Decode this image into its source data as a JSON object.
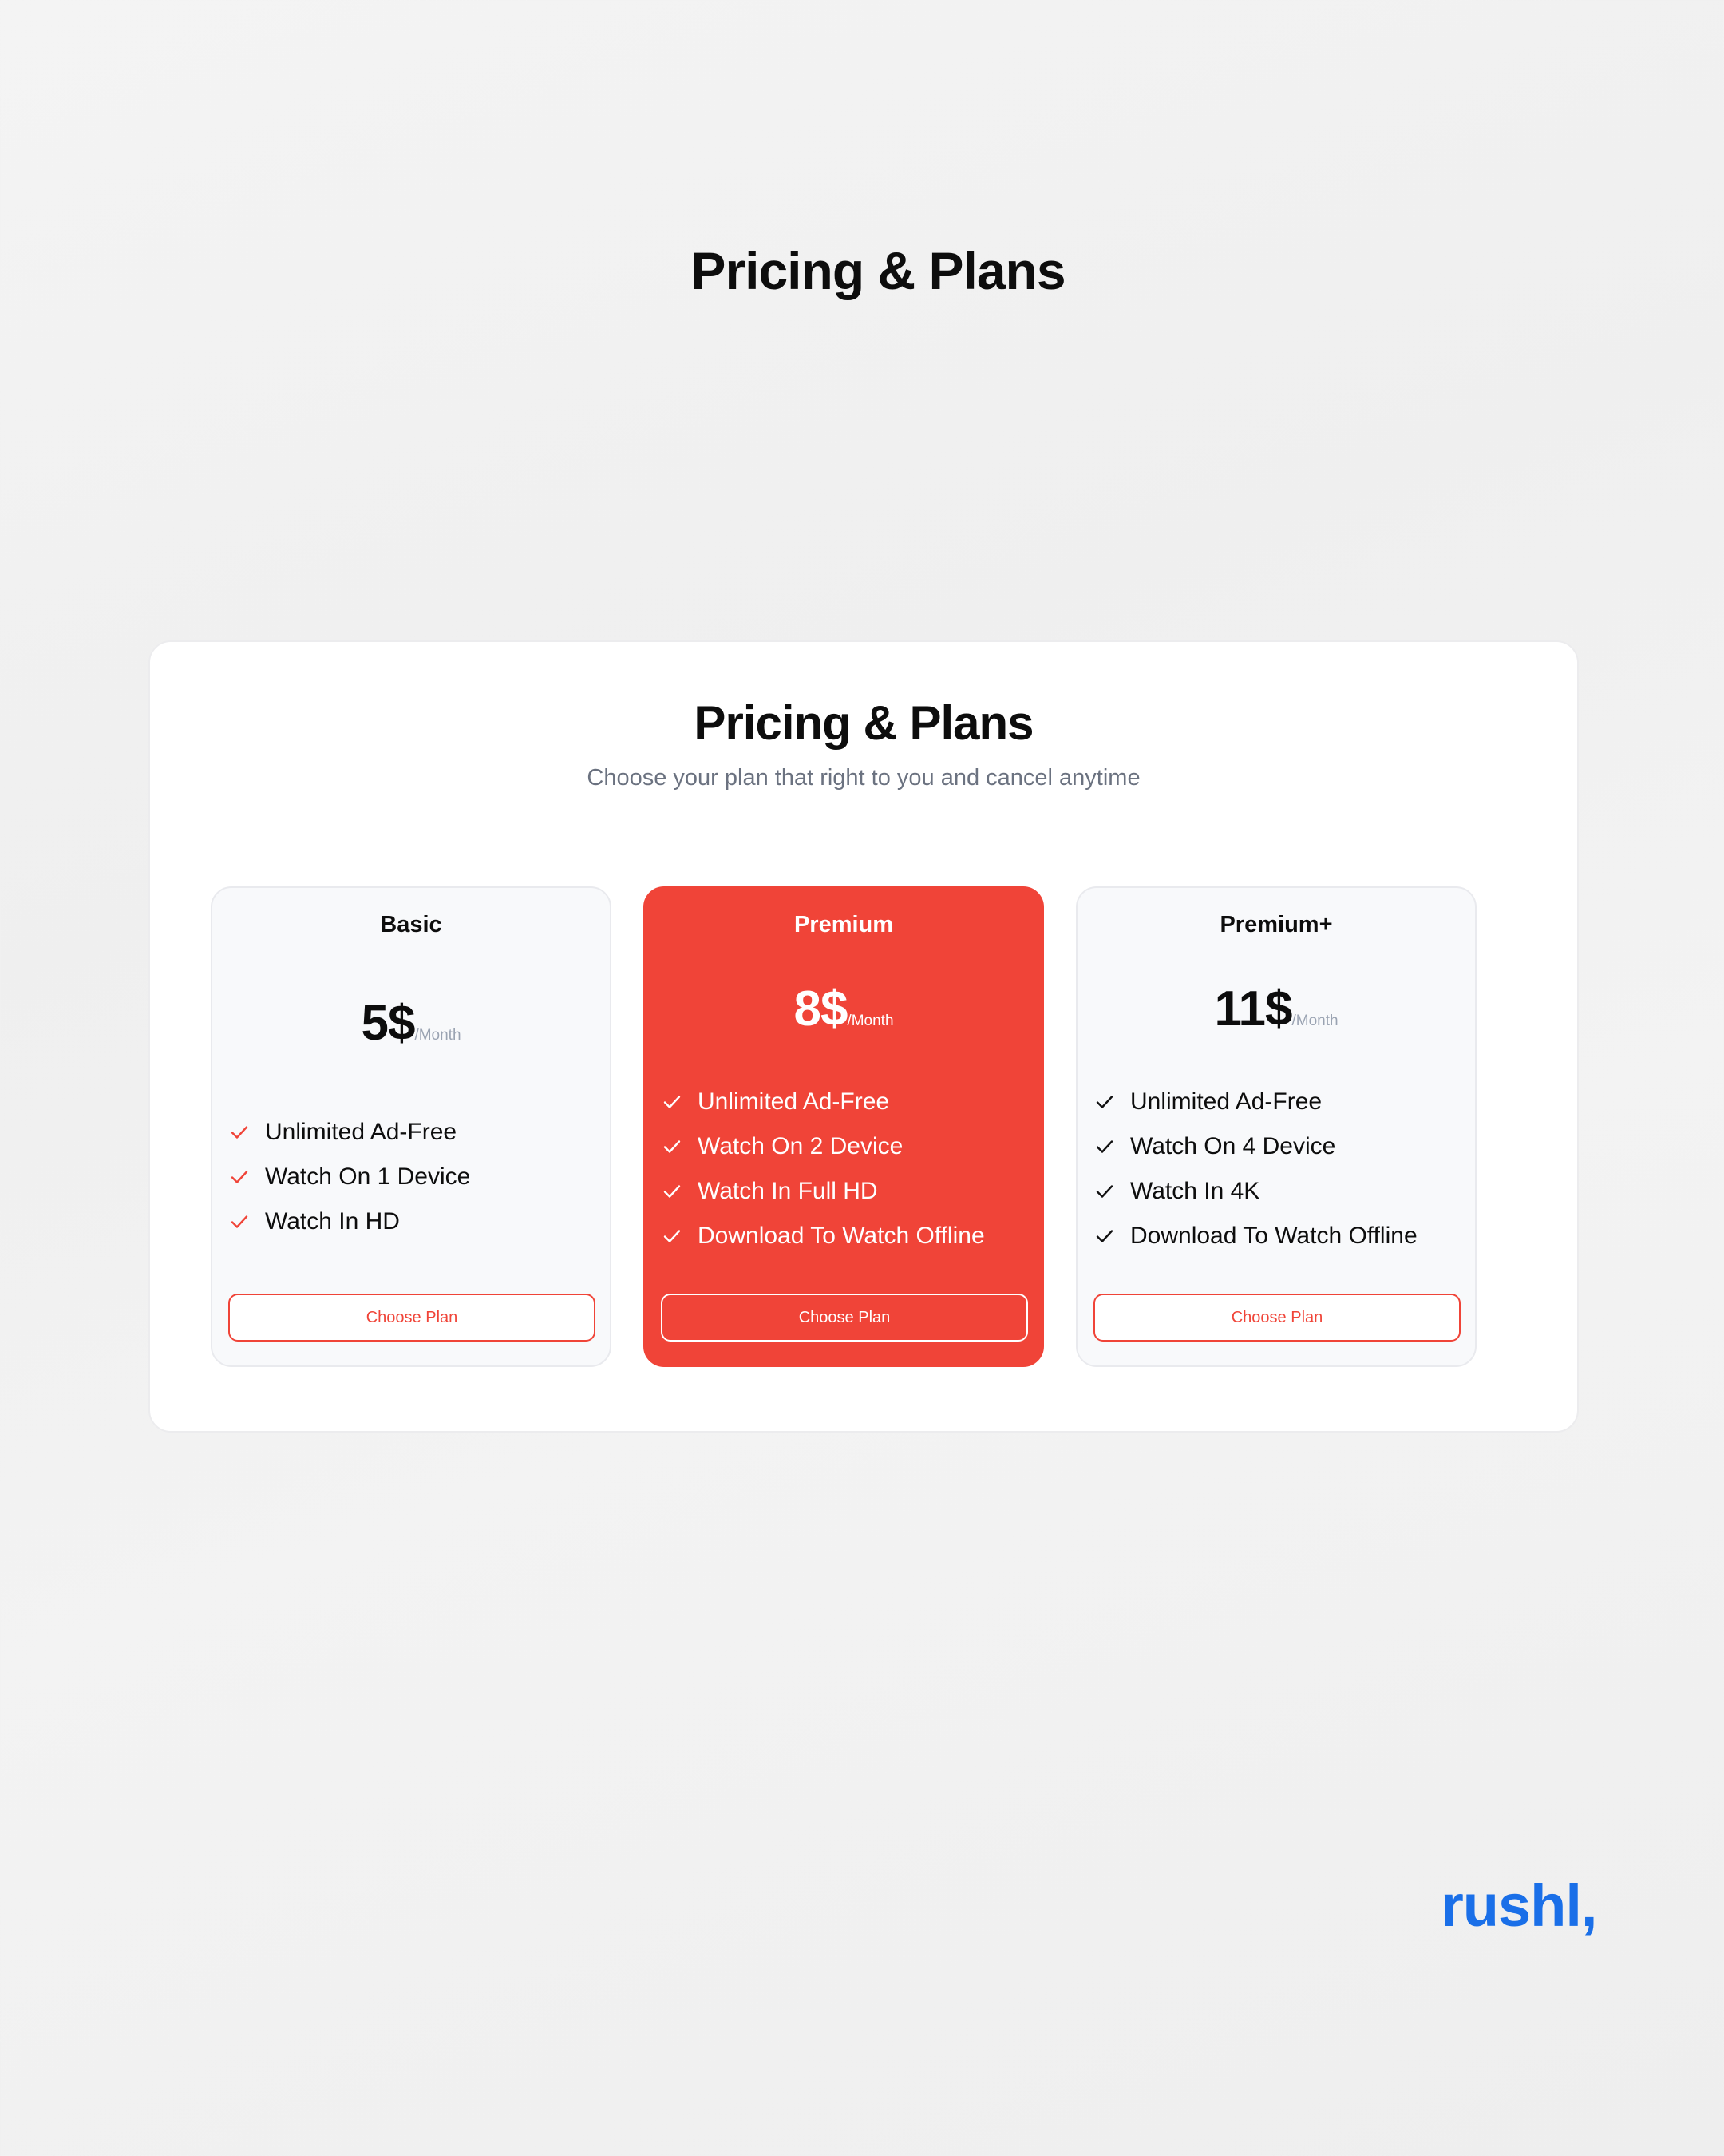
{
  "page": {
    "title": "Pricing & Plans"
  },
  "panel": {
    "title": "Pricing & Plans",
    "subtitle": "Choose your plan that right to you and cancel anytime"
  },
  "plans": [
    {
      "name": "Basic",
      "price": "5$",
      "period": "/Month",
      "featured": false,
      "check_icon": "check-icon",
      "check_color": "#f04438",
      "features": [
        "Unlimited Ad-Free",
        "Watch On 1 Device",
        "Watch In HD"
      ],
      "button_label": "Choose Plan"
    },
    {
      "name": "Premium",
      "price": "8$",
      "period": "/Month",
      "featured": true,
      "check_icon": "check-icon",
      "check_color": "#ffffff",
      "features": [
        "Unlimited Ad-Free",
        "Watch On 2 Device",
        "Watch In Full HD",
        "Download To Watch Offline"
      ],
      "button_label": "Choose Plan"
    },
    {
      "name": "Premium+",
      "price": "11$",
      "period": "/Month",
      "featured": false,
      "check_icon": "check-icon",
      "check_color": "#111111",
      "features": [
        "Unlimited Ad-Free",
        "Watch On 4 Device",
        "Watch In 4K",
        "Download To Watch Offline"
      ],
      "button_label": "Choose Plan"
    }
  ],
  "brand": {
    "logo_text": "rushl,"
  },
  "colors": {
    "accent": "#f04438",
    "brand": "#1a6fe8",
    "muted_text": "#6b7280",
    "card_bg": "#f8f9fb"
  }
}
